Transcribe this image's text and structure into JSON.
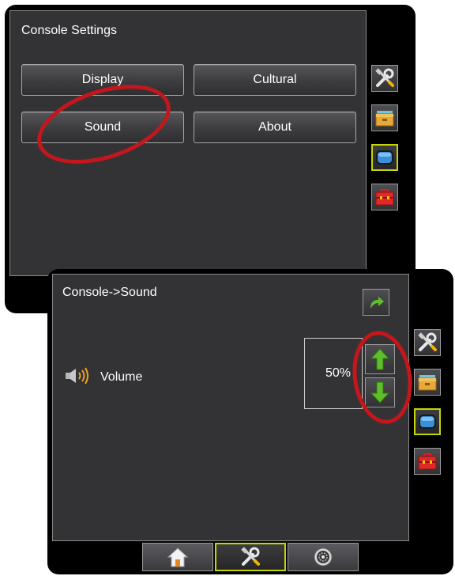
{
  "console_settings": {
    "title": "Console Settings",
    "buttons": {
      "display": "Display",
      "cultural": "Cultural",
      "sound": "Sound",
      "about": "About"
    },
    "side_tabs": [
      "tools-icon",
      "folder-icon",
      "monitor-icon",
      "toolbox-icon"
    ],
    "selected_side_tab": "monitor-icon"
  },
  "sound_screen": {
    "title": "Console->Sound",
    "volume_label": "Volume",
    "volume_value": "50%",
    "volume_level": 0.5,
    "side_tabs": [
      "tools-icon",
      "folder-icon",
      "monitor-icon",
      "toolbox-icon"
    ],
    "selected_side_tab": "monitor-icon",
    "bottom_tabs": [
      "home-icon",
      "tools-icon",
      "gauge-icon"
    ],
    "selected_bottom_tab": "tools-icon"
  },
  "colors": {
    "panel": "#333335",
    "highlight_border": "#c6d600",
    "annotation": "#c4161c",
    "arrow_green": "#5fbf2a",
    "speaker_orange": "#f0a020"
  }
}
